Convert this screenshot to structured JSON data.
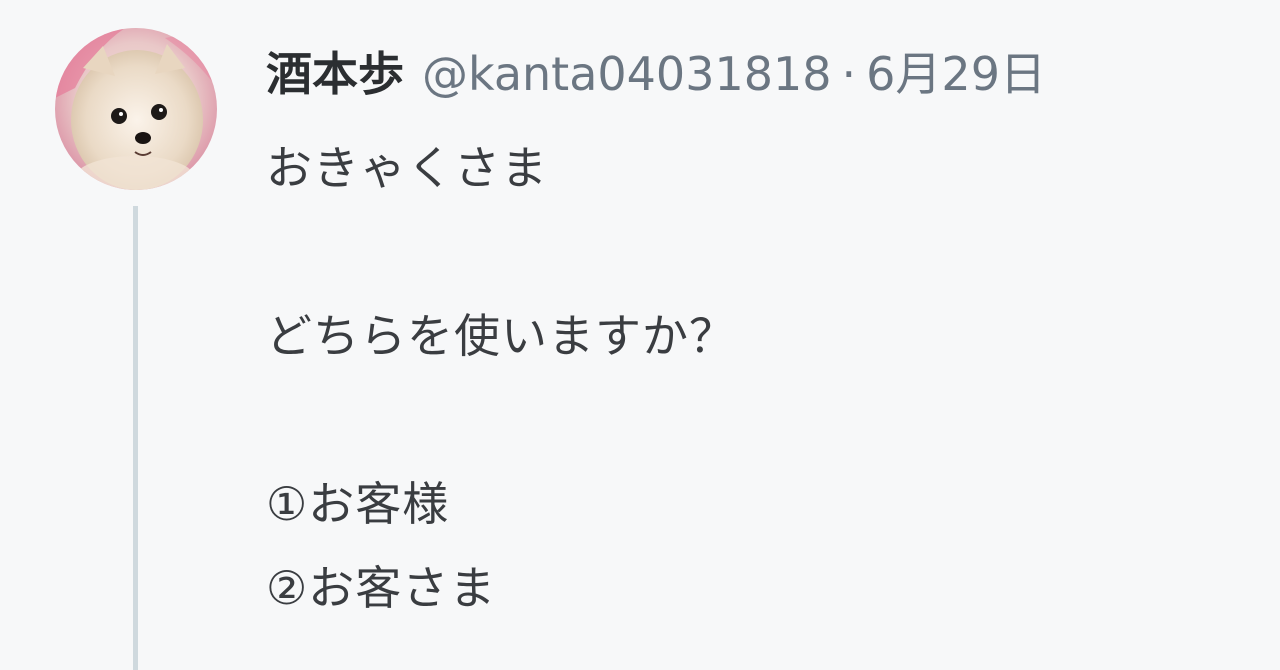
{
  "tweet": {
    "author": {
      "display_name": "酒本歩",
      "handle": "@kanta04031818",
      "avatar_icon": "pomeranian-dog-photo"
    },
    "separator": "·",
    "date": "6月29日",
    "lines": [
      "おきゃくさま",
      "",
      "どちらを使いますか？",
      "",
      "①お客様",
      "②お客さま"
    ]
  },
  "colors": {
    "background": "#f7f8f9",
    "thread_line": "#cfd9de",
    "name": "#2b2e31",
    "muted": "#6b7682",
    "text": "#3a3d41"
  }
}
